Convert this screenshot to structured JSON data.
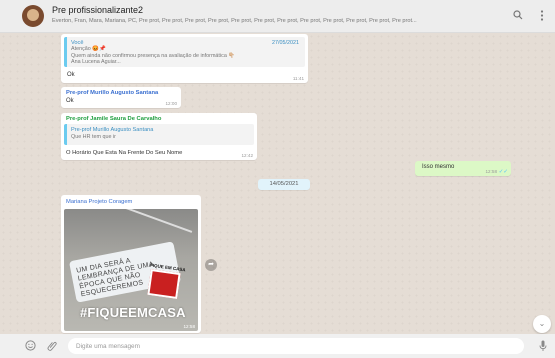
{
  "header": {
    "title": "Pre profissionalizante2",
    "members": "Everton, Fran, Mara, Mariana, PC, Pre prot, Pre prot, Pre prot, Pre prot, Pre prot, Pre prot, Pre prot, Pre prot, Pre prot, Pre prot, Pre prot, Pre prot..."
  },
  "messages": {
    "m1": {
      "quote_name": "Você",
      "quote_date": "27/05/2021",
      "quote_line1": "Atenção 😡📌",
      "quote_line2": "Quem ainda não confirmou presença na avaliação de informática 👇🏼",
      "quote_line3": "Ana Lucena Aguiar...",
      "text": "Ok",
      "time": "11:41"
    },
    "m2": {
      "sender": "Pre-prof Murillo Augusto Santana",
      "text": "Ok",
      "time": "12:00"
    },
    "m3": {
      "sender": "Pre-prof Jamile Saura De Carvalho",
      "quote_name": "Pre-prof Murillo Augusto Santana",
      "quote_text": "Que HR tem que ir",
      "text": "O Horário Que Esta Na Frente Do Seu Nome",
      "time": "12:42"
    },
    "m4": {
      "text": "Isso mesmo",
      "time": "12:58"
    },
    "date_chip": "14/05/2021",
    "m5": {
      "sender": "Mariana Projeto Coragem",
      "mask_text": "UM DIA SERÁ A LEMBRANÇA DE UMA ÉPOCA QUE NÃO ESQUECEREMOS",
      "badge_label": "FIQUE EM CASA",
      "hashtag": "#FIQUEEMCASA",
      "time": "12:58"
    }
  },
  "footer": {
    "placeholder": "Digite uma mensagem"
  },
  "icons": {
    "search": "search-icon",
    "menu": "menu-icon",
    "emoji": "emoji-icon",
    "attach": "attach-icon",
    "mic": "mic-icon",
    "forward": "forward-icon",
    "scroll_down": "chevron-down-icon",
    "read_ticks": "double-check-icon"
  },
  "colors": {
    "chat_bg": "#e5ddd5",
    "outgoing": "#dcf8c6",
    "header": "#ededed"
  }
}
